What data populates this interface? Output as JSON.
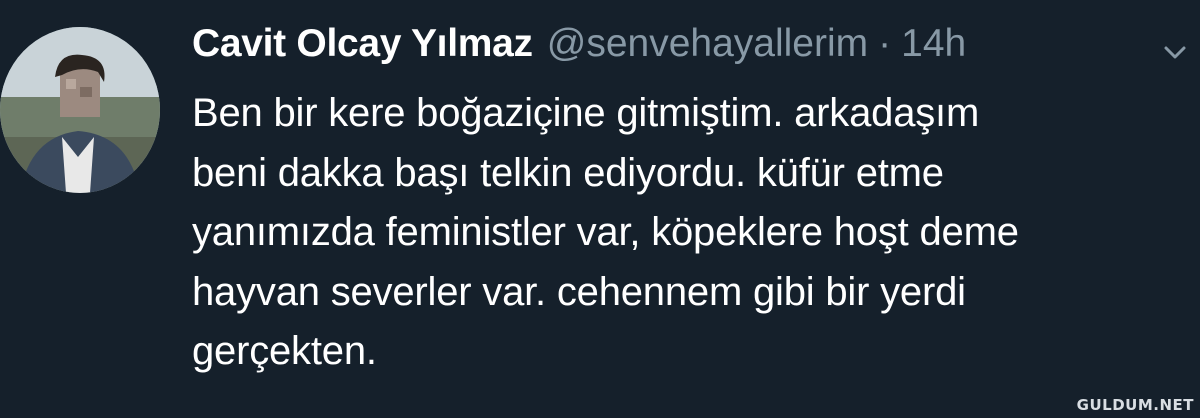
{
  "tweet": {
    "display_name": "Cavit Olcay Yılmaz",
    "handle": "@senvehayallerim",
    "separator": "·",
    "timestamp": "14h",
    "text_lines": [
      "Ben bir kere boğaziçine gitmiştim. arkadaşım",
      "beni dakka başı telkin ediyordu. küfür etme",
      "yanımızda feministler var, köpeklere hoşt deme",
      "hayvan severler var. cehennem gibi bir yerdi",
      "gerçekten."
    ],
    "menu_icon": "chevron-down-icon",
    "avatar": "profile-photo"
  },
  "watermark": "GULDUM.NET",
  "colors": {
    "background": "#15202b",
    "primary_text": "#ffffff",
    "secondary_text": "#8899a6"
  }
}
